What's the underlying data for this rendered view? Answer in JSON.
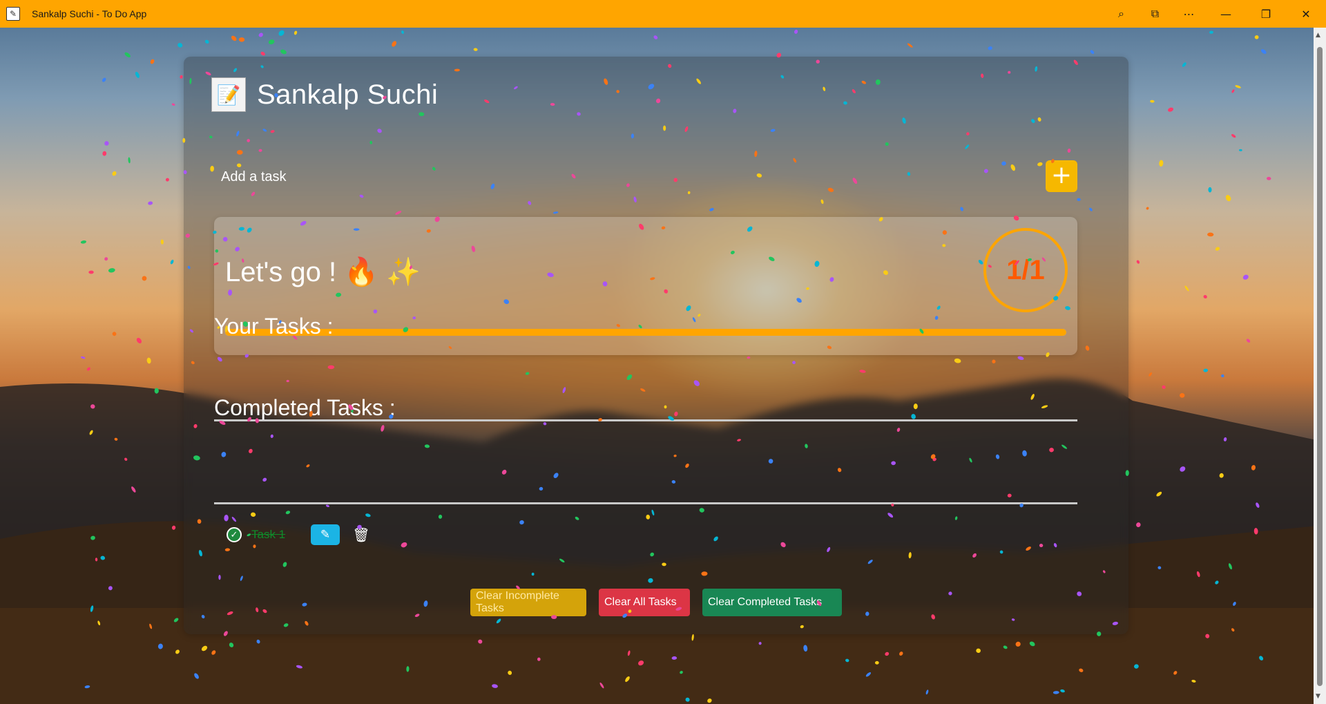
{
  "window": {
    "title": "Sankalp Suchi - To Do App",
    "app_icon": "notepad-icon",
    "controls": [
      "zoom-icon",
      "split-icon",
      "more-icon",
      "minimize-icon",
      "restore-icon",
      "close-icon"
    ]
  },
  "app": {
    "brand_title": "Sankalp Suchi",
    "brand_icon": "clipboard-icon"
  },
  "add_task": {
    "placeholder": "Add a task",
    "add_label": "+"
  },
  "progress": {
    "message": "Let's go ! 🔥 ✨",
    "count": "1/1",
    "completed_fraction": 1.0,
    "accent": "#ffa500"
  },
  "sections": {
    "your_tasks": "Your Tasks :",
    "completed_tasks": "Completed Tasks :"
  },
  "completed": [
    {
      "text": "Task 1"
    }
  ],
  "actions": {
    "clear_incomplete": "Clear Incomplete Tasks",
    "clear_all": "Clear All Tasks",
    "clear_completed": "Clear Completed Tasks"
  },
  "colors": {
    "titlebar": "#ffa500",
    "add_button": "#f6b800",
    "edit_button": "#1bb4e5",
    "clear_incomplete": "#d4a30a",
    "clear_all": "#dc3545",
    "clear_completed": "#198754"
  }
}
